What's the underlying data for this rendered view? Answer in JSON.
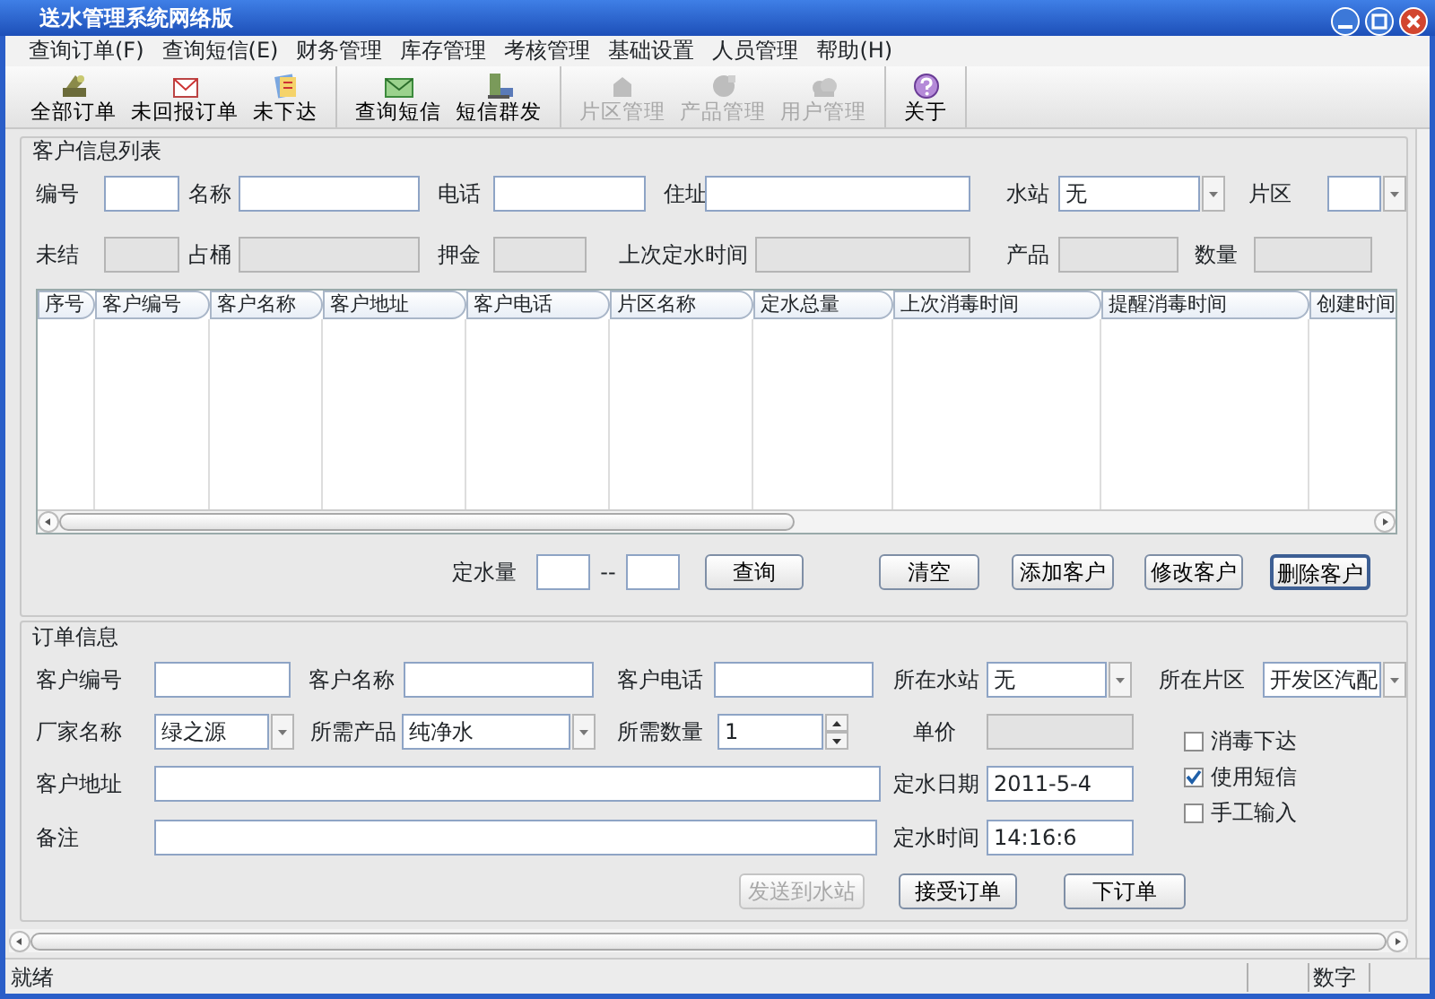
{
  "window": {
    "title": "送水管理系统网络版"
  },
  "menu": [
    "查询订单(F)",
    "查询短信(E)",
    "财务管理",
    "库存管理",
    "考核管理",
    "基础设置",
    "人员管理",
    "帮助(H)"
  ],
  "toolbar": [
    [
      {
        "label": "全部订单",
        "disabled": false
      },
      {
        "label": "未回报订单",
        "disabled": false
      },
      {
        "label": "未下达",
        "disabled": false
      }
    ],
    [
      {
        "label": "查询短信",
        "disabled": false
      },
      {
        "label": "短信群发",
        "disabled": false
      }
    ],
    [
      {
        "label": "片区管理",
        "disabled": true
      },
      {
        "label": "产品管理",
        "disabled": true
      },
      {
        "label": "用户管理",
        "disabled": true
      }
    ],
    [
      {
        "label": "关于",
        "disabled": false
      }
    ]
  ],
  "customer_list": {
    "title": "客户信息列表",
    "filter_rows": [
      [
        {
          "label": "编号",
          "kind": "text"
        },
        {
          "label": "名称",
          "kind": "text"
        },
        {
          "label": "电话",
          "kind": "text"
        },
        {
          "label": "住址",
          "kind": "text"
        },
        {
          "label": "水站",
          "kind": "combo",
          "value": "无"
        },
        {
          "label": "片区",
          "kind": "combo"
        }
      ],
      [
        {
          "label": "未结",
          "kind": "readonly"
        },
        {
          "label": "占桶",
          "kind": "readonly"
        },
        {
          "label": "押金",
          "kind": "readonly"
        },
        {
          "label": "上次定水时间",
          "kind": "readonly"
        },
        {
          "label": "产品",
          "kind": "readonly"
        },
        {
          "label": "数量",
          "kind": "readonly"
        }
      ]
    ],
    "table": {
      "columns": [
        "序号",
        "客户编号",
        "客户名称",
        "客户地址",
        "客户电话",
        "片区名称",
        "定水总量",
        "上次消毒时间",
        "提醒消毒时间",
        "创建时间"
      ]
    },
    "range": {
      "label": "定水量",
      "separator": "--"
    },
    "buttons": [
      {
        "label": "查询",
        "default": false
      },
      {
        "label": "清空",
        "default": false
      },
      {
        "label": "添加客户",
        "default": false
      },
      {
        "label": "修改客户",
        "default": false
      },
      {
        "label": "删除客户",
        "default": true
      }
    ]
  },
  "order": {
    "title": "订单信息",
    "top_row": [
      {
        "label": "客户编号",
        "kind": "text"
      },
      {
        "label": "客户名称",
        "kind": "text"
      },
      {
        "label": "客户电话",
        "kind": "text"
      },
      {
        "label": "所在水站",
        "kind": "combo",
        "value": "无"
      },
      {
        "label": "所在片区",
        "kind": "combo",
        "value": "开发区汽配"
      }
    ],
    "rows": [
      [
        {
          "label": "厂家名称",
          "kind": "combo",
          "value": "绿之源"
        },
        {
          "label": "所需产品",
          "kind": "combo",
          "value": "纯净水"
        },
        {
          "label": "所需数量",
          "kind": "spin",
          "value": "1"
        },
        {
          "label": "单价",
          "kind": "readonly"
        }
      ],
      [
        {
          "label": "客户地址",
          "kind": "text"
        },
        {
          "label": "定水日期",
          "kind": "text",
          "value": "2011-5-4"
        }
      ],
      [
        {
          "label": "备注",
          "kind": "text"
        },
        {
          "label": "定水时间",
          "kind": "text",
          "value": "14:16:6"
        }
      ]
    ],
    "options": [
      {
        "label": "消毒下达",
        "checked": false
      },
      {
        "label": "使用短信",
        "checked": true
      },
      {
        "label": "手工输入",
        "checked": false
      }
    ],
    "buttons": [
      {
        "label": "发送到水站",
        "disabled": true
      },
      {
        "label": "接受订单",
        "disabled": false
      },
      {
        "label": "下订单",
        "disabled": false
      }
    ]
  },
  "status_bar": {
    "message": "就绪",
    "num_lock": "数字"
  }
}
